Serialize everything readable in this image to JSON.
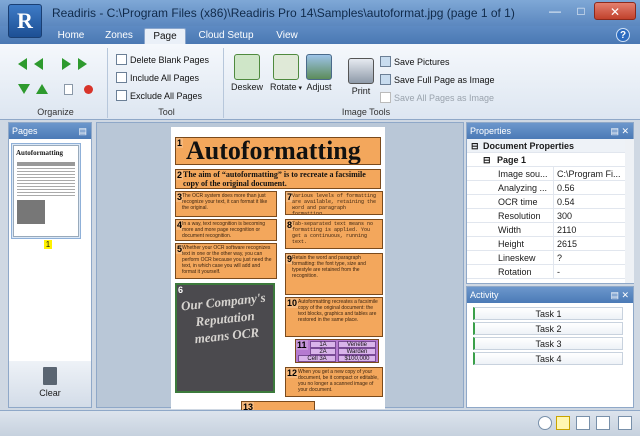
{
  "window": {
    "title": "Readiris - C:\\Program Files (x86)\\Readiris Pro 14\\Samples\\autoformat.jpg (page 1 of 1)",
    "app_icon_letter": "R"
  },
  "tabs": [
    {
      "label": "Home",
      "active": false
    },
    {
      "label": "Zones",
      "active": false
    },
    {
      "label": "Page",
      "active": true
    },
    {
      "label": "Cloud Setup",
      "active": false
    },
    {
      "label": "View",
      "active": false
    }
  ],
  "help_label": "?",
  "ribbon": {
    "organize": {
      "label": "Organize"
    },
    "tool": {
      "label": "Tool",
      "delete_blank": "Delete Blank Pages",
      "include_all": "Include All Pages",
      "exclude_all": "Exclude All Pages"
    },
    "image_tools": {
      "label": "Image Tools",
      "deskew": "Deskew",
      "rotate": "Rotate",
      "adjust": "Adjust",
      "print": "Print",
      "save_pictures": "Save Pictures",
      "save_full_page": "Save Full Page as Image",
      "save_all_pages": "Save All Pages as Image"
    }
  },
  "pages_pane": {
    "title": "Pages",
    "thumb_number": "1",
    "thumb_title": "Autoformatting",
    "clear_label": "Clear"
  },
  "document": {
    "title": "Autoformatting",
    "subtitle": "The aim of “autoformatting” is to recreate a facsimile copy of the original document.",
    "zones": [
      {
        "n": "1"
      },
      {
        "n": "2"
      },
      {
        "n": "3",
        "text": "The OCR system does more than just recognize your text, it can format it like the original."
      },
      {
        "n": "4",
        "text": "In a way, text recognition is becoming more and more page recognition or document recognition."
      },
      {
        "n": "5",
        "text": "Whether your OCR software recognizes text in one or the other way, you can perform OCR because you just need the text, in which case you will add and format it yourself."
      },
      {
        "n": "6"
      },
      {
        "n": "7",
        "text": "Various levels of formatting are available, retaining the word and paragraph formatting."
      },
      {
        "n": "8",
        "text": "Tab-separated text means no formatting is applied. You get a continuous, running text."
      },
      {
        "n": "9",
        "text": "Retain the word and paragraph formatting: the font type, size and typestyle are retained from the recognition."
      },
      {
        "n": "10",
        "text": "Autoformatting recreates a facsimile copy of the original document: the text blocks, graphics and tables are restored in the same place."
      },
      {
        "n": "11"
      },
      {
        "n": "12",
        "text": "When you get a new copy of your document, be it compact or editable, you no longer a scanned image of your document."
      },
      {
        "n": "13"
      }
    ],
    "image_text": "Our Company's Reputation means OCR",
    "table": {
      "r1": [
        "1A",
        "Venetie"
      ],
      "r2": [
        "2A",
        "Warden"
      ],
      "r3": [
        "Cell 3A",
        "$100,000"
      ]
    }
  },
  "properties": {
    "title": "Properties",
    "groups": [
      {
        "label": "Document Properties"
      },
      {
        "label": "Page 1"
      }
    ],
    "rows": [
      {
        "name": "Image sou...",
        "value": "C:\\Program Fi..."
      },
      {
        "name": "Analyzing ...",
        "value": "0.56"
      },
      {
        "name": "OCR time",
        "value": "0.54"
      },
      {
        "name": "Resolution",
        "value": "300"
      },
      {
        "name": "Width",
        "value": "2110"
      },
      {
        "name": "Height",
        "value": "2615"
      },
      {
        "name": "Lineskew",
        "value": "?"
      },
      {
        "name": "Rotation",
        "value": "-"
      }
    ]
  },
  "activity": {
    "title": "Activity",
    "tasks": [
      "Task 1",
      "Task 2",
      "Task 3",
      "Task 4"
    ]
  },
  "colors": {
    "accent": "#4b7ab6",
    "zone_text": "#f3a75c",
    "zone_image": "#4b4a4e",
    "zone_table": "#b57ad0",
    "highlight": "#fff200"
  }
}
